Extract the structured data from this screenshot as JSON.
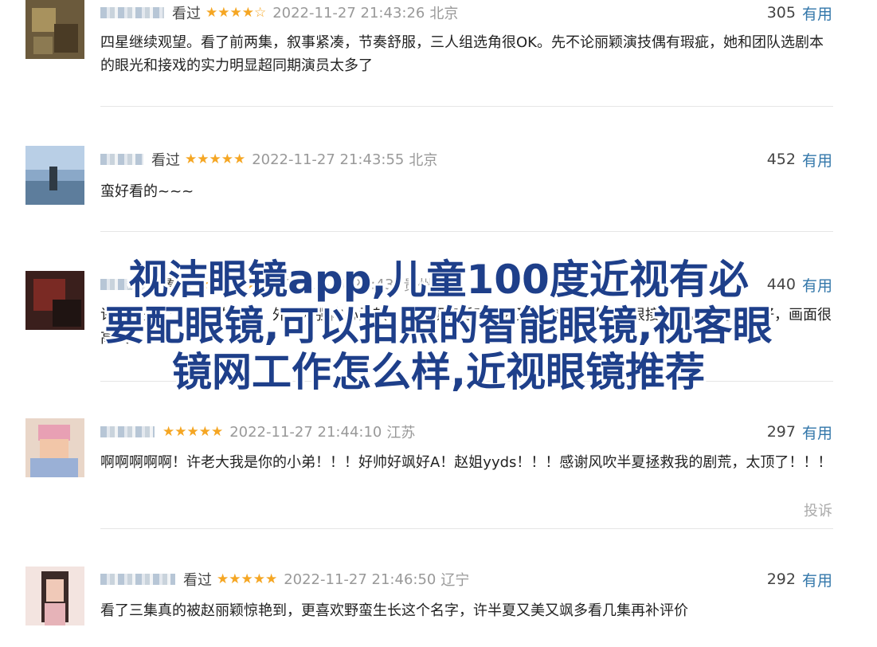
{
  "overlay": {
    "line1": "视洁眼镜app,儿童100度近视有必",
    "line2": "要配眼镜,可以拍照的智能眼镜,视客眼",
    "line3": "镜网工作怎么样,近视眼镜推荐"
  },
  "reviews": [
    {
      "status": "看过",
      "stars": "★★★★☆",
      "time": "2022-11-27 21:43:26",
      "location": "北京",
      "votes": "305",
      "useful": "有用",
      "content": "四星继续观望。看了前两集，叙事紧凑，节奏舒服，三人组选角很OK。先不论丽颖演技偶有瑕疵，她和团队选剧本的眼光和接戏的实力明显超同期演员太多了"
    },
    {
      "status": "看过",
      "stars": "★★★★★",
      "time": "2022-11-27 21:43:55",
      "location": "北京",
      "votes": "452",
      "useful": "有用",
      "content": "蛮好看的~~~"
    },
    {
      "status": "看过",
      "stars": "★★★★★",
      "time": "2022-11-27 21:43:",
      "location": "贵州",
      "votes": "440",
      "useful": "有用",
      "content": "许半夏是个立起来的人物，外表刚强内心柔软，赵丽颖演活了。赵又廷的童骁骑演得很接地气，配角也很好，画面很高级"
    },
    {
      "status": "",
      "stars": "★★★★★",
      "time": "2022-11-27 21:44:10",
      "location": "江苏",
      "votes": "297",
      "useful": "有用",
      "content": "啊啊啊啊啊！许老大我是你的小弟！！！好帅好飒好A！赵姐yyds！！！感谢风吹半夏拯救我的剧荒，太顶了！！！",
      "report": "投诉"
    },
    {
      "status": "看过",
      "stars": "★★★★★",
      "time": "2022-11-27 21:46:50",
      "location": "辽宁",
      "votes": "292",
      "useful": "有用",
      "content": "看了三集真的被赵丽颖惊艳到，更喜欢野蛮生长这个名字，许半夏又美又飒多看几集再补评价"
    }
  ],
  "colors": {
    "accent": "#3377aa",
    "star": "#f5a623",
    "overlay_text": "#1e3f8a"
  }
}
